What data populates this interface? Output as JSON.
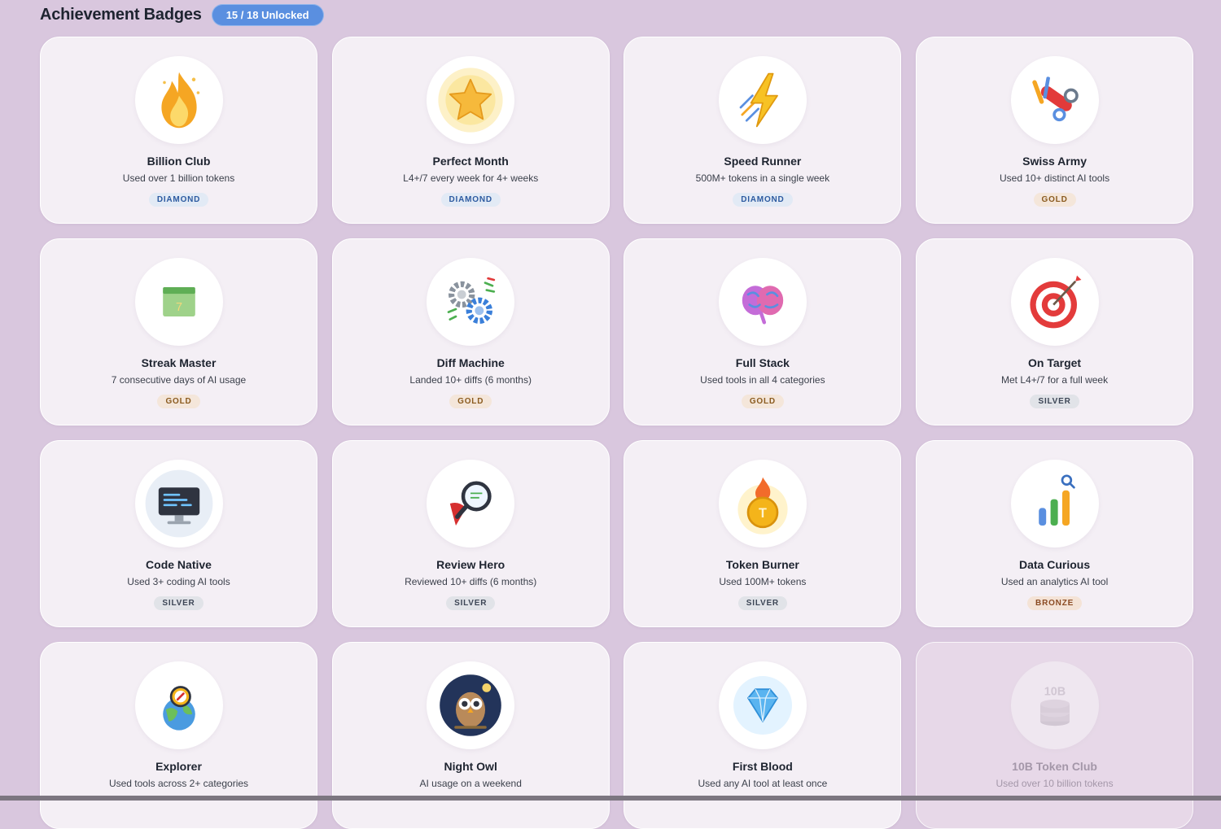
{
  "header": {
    "title": "Achievement Badges",
    "unlocked_label": "15 / 18 Unlocked"
  },
  "colors": {
    "background": "#d9c7de",
    "card": "#f4eff5",
    "pill": "#5a8fe0",
    "diamond": "#2c5aa0",
    "gold": "#8a5a1e",
    "silver": "#3d4656",
    "bronze": "#8a4a22"
  },
  "badges": [
    {
      "name": "Billion Club",
      "desc": "Used over 1 billion tokens",
      "tier": "DIAMOND",
      "icon": "flame-icon"
    },
    {
      "name": "Perfect Month",
      "desc": "L4+/7 every week for 4+ weeks",
      "tier": "DIAMOND",
      "icon": "star-icon"
    },
    {
      "name": "Speed Runner",
      "desc": "500M+ tokens in a single week",
      "tier": "DIAMOND",
      "icon": "lightning-icon"
    },
    {
      "name": "Swiss Army",
      "desc": "Used 10+ distinct AI tools",
      "tier": "GOLD",
      "icon": "tools-icon"
    },
    {
      "name": "Streak Master",
      "desc": "7 consecutive days of AI usage",
      "tier": "GOLD",
      "icon": "calendar-icon",
      "icon_text": "7"
    },
    {
      "name": "Diff Machine",
      "desc": "Landed 10+ diffs (6 months)",
      "tier": "GOLD",
      "icon": "gears-icon"
    },
    {
      "name": "Full Stack",
      "desc": "Used tools in all 4 categories",
      "tier": "GOLD",
      "icon": "brain-icon"
    },
    {
      "name": "On Target",
      "desc": "Met L4+/7 for a full week",
      "tier": "SILVER",
      "icon": "target-icon"
    },
    {
      "name": "Code Native",
      "desc": "Used 3+ coding AI tools",
      "tier": "SILVER",
      "icon": "monitor-code-icon"
    },
    {
      "name": "Review Hero",
      "desc": "Reviewed 10+ diffs (6 months)",
      "tier": "SILVER",
      "icon": "magnifier-cape-icon"
    },
    {
      "name": "Token Burner",
      "desc": "Used 100M+ tokens",
      "tier": "SILVER",
      "icon": "burning-coin-icon"
    },
    {
      "name": "Data Curious",
      "desc": "Used an analytics AI tool",
      "tier": "BRONZE",
      "icon": "bar-chart-icon"
    },
    {
      "name": "Explorer",
      "desc": "Used tools across 2+ categories",
      "tier": "",
      "icon": "compass-globe-icon"
    },
    {
      "name": "Night Owl",
      "desc": "AI usage on a weekend",
      "tier": "",
      "icon": "owl-icon"
    },
    {
      "name": "First Blood",
      "desc": "Used any AI tool at least once",
      "tier": "",
      "icon": "diamond-icon"
    },
    {
      "name": "10B Token Club",
      "desc": "Used over 10 billion tokens",
      "tier": "",
      "icon": "coin-stack-icon",
      "icon_text": "10B",
      "locked": true
    }
  ]
}
